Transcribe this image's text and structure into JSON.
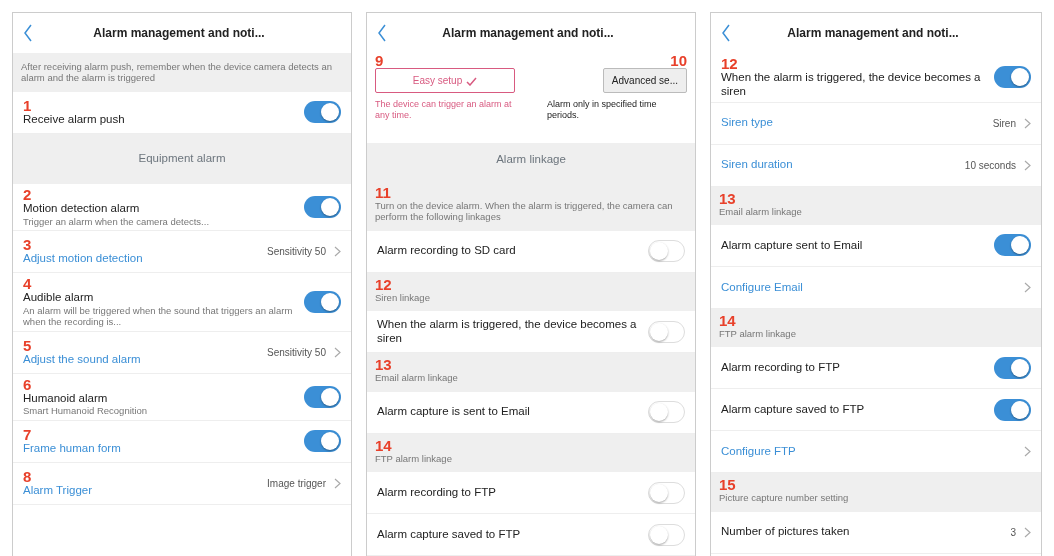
{
  "panels": [
    {
      "title": "Alarm management and noti...",
      "items": [
        {
          "kind": "note",
          "text": "After receiving alarm push, remember when the device camera detects an alarm and the alarm is triggered"
        },
        {
          "kind": "switch",
          "callout": "1",
          "label": "Receive alarm push",
          "on": true
        },
        {
          "kind": "heading",
          "text": "Equipment alarm"
        },
        {
          "kind": "switch",
          "callout": "2",
          "label": "Motion detection alarm",
          "sub": "Trigger an alarm when the camera detects...",
          "on": true
        },
        {
          "kind": "link",
          "callout": "3",
          "label": "Adjust motion detection",
          "value": "Sensitivity 50"
        },
        {
          "kind": "switch",
          "callout": "4",
          "label": "Audible alarm",
          "sub": "An alarm will be triggered when the sound that triggers an alarm when the recording is...",
          "on": true
        },
        {
          "kind": "link",
          "callout": "5",
          "label": "Adjust the sound alarm",
          "value": "Sensitivity 50"
        },
        {
          "kind": "switch",
          "callout": "6",
          "label": "Humanoid alarm",
          "sub": "Smart Humanoid Recognition",
          "on": true
        },
        {
          "kind": "switch",
          "callout": "7",
          "label": "Frame human form",
          "link": true,
          "on": true
        },
        {
          "kind": "link",
          "callout": "8",
          "label": "Alarm Trigger",
          "value": "Image trigger"
        }
      ]
    },
    {
      "title": "Alarm management and noti...",
      "items": [
        {
          "kind": "modes",
          "options": [
            {
              "callout": "9",
              "label": "Easy setup",
              "selected": true,
              "caption": "The device can trigger an alarm at any time."
            },
            {
              "callout": "10",
              "label": "Advanced se...",
              "selected": false,
              "caption": "Alarm only in specified time periods."
            }
          ]
        },
        {
          "kind": "heading",
          "text": "Alarm linkage"
        },
        {
          "kind": "note",
          "callout": "11",
          "text": "Turn on the device alarm. When the alarm is triggered, the camera can perform the following linkages"
        },
        {
          "kind": "switch",
          "label": "Alarm recording to SD card",
          "on": false
        },
        {
          "kind": "section",
          "callout": "12",
          "text": "Siren linkage"
        },
        {
          "kind": "switch",
          "label": "When the alarm is triggered, the device becomes a siren",
          "on": false
        },
        {
          "kind": "section",
          "callout": "13",
          "text": "Email alarm linkage"
        },
        {
          "kind": "switch",
          "label": "Alarm capture is sent to Email",
          "on": false
        },
        {
          "kind": "section",
          "callout": "14",
          "text": "FTP alarm linkage"
        },
        {
          "kind": "switch",
          "label": "Alarm recording to FTP",
          "on": false
        },
        {
          "kind": "switch",
          "label": "Alarm capture saved to FTP",
          "on": false
        }
      ]
    },
    {
      "title": "Alarm management and noti...",
      "items": [
        {
          "kind": "switch",
          "callout": "12",
          "label": "When the alarm is triggered, the device becomes a siren",
          "on": true
        },
        {
          "kind": "link",
          "label": "Siren type",
          "value": "Siren"
        },
        {
          "kind": "link",
          "label": "Siren duration",
          "value": "10 seconds"
        },
        {
          "kind": "section",
          "callout": "13",
          "text": "Email alarm linkage"
        },
        {
          "kind": "switch",
          "label": "Alarm capture sent to Email",
          "on": true
        },
        {
          "kind": "link",
          "label": "Configure Email"
        },
        {
          "kind": "section",
          "callout": "14",
          "text": "FTP alarm linkage"
        },
        {
          "kind": "switch",
          "label": "Alarm recording to FTP",
          "on": true
        },
        {
          "kind": "switch",
          "label": "Alarm capture saved to FTP",
          "on": true
        },
        {
          "kind": "link",
          "label": "Configure FTP"
        },
        {
          "kind": "section",
          "callout": "15",
          "text": "Picture capture number setting"
        },
        {
          "kind": "link",
          "label": "Number of pictures taken",
          "plain": true,
          "value": "3"
        }
      ]
    }
  ]
}
